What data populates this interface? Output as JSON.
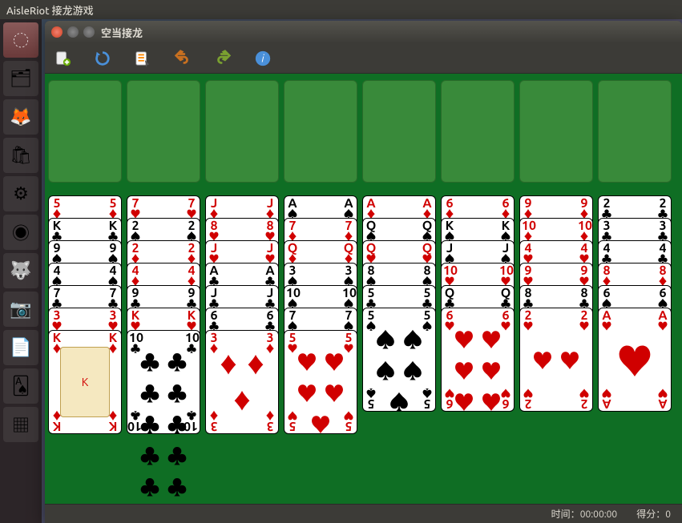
{
  "top_panel": {
    "title": "AisleRiot 接龙游戏"
  },
  "window": {
    "title": "空当接龙"
  },
  "toolbar": {
    "tooltips": {
      "new": "新游戏",
      "restart": "重新开始",
      "select": "选择游戏",
      "undo": "撤销",
      "redo": "重做",
      "hint": "提示"
    }
  },
  "statusbar": {
    "time_label": "时间：",
    "time_value": "00:00:00",
    "score_label": "得分：",
    "score_value": "0"
  },
  "suits": {
    "H": "♥",
    "D": "♦",
    "C": "♣",
    "S": "♠"
  },
  "chart_data": {
    "type": "table",
    "title": "FreeCell tableau — cards listed top-of-column → bottom",
    "columns": [
      [
        {
          "r": "5",
          "s": "D"
        },
        {
          "r": "K",
          "s": "C"
        },
        {
          "r": "9",
          "s": "S"
        },
        {
          "r": "4",
          "s": "S"
        },
        {
          "r": "7",
          "s": "C"
        },
        {
          "r": "3",
          "s": "H"
        },
        {
          "r": "K",
          "s": "D"
        }
      ],
      [
        {
          "r": "7",
          "s": "H"
        },
        {
          "r": "2",
          "s": "S"
        },
        {
          "r": "2",
          "s": "D"
        },
        {
          "r": "4",
          "s": "D"
        },
        {
          "r": "9",
          "s": "C"
        },
        {
          "r": "K",
          "s": "H"
        },
        {
          "r": "10",
          "s": "C"
        }
      ],
      [
        {
          "r": "J",
          "s": "D"
        },
        {
          "r": "8",
          "s": "H"
        },
        {
          "r": "J",
          "s": "H"
        },
        {
          "r": "A",
          "s": "C"
        },
        {
          "r": "J",
          "s": "C"
        },
        {
          "r": "6",
          "s": "C"
        },
        {
          "r": "3",
          "s": "D"
        }
      ],
      [
        {
          "r": "A",
          "s": "S"
        },
        {
          "r": "7",
          "s": "D"
        },
        {
          "r": "Q",
          "s": "D"
        },
        {
          "r": "3",
          "s": "S"
        },
        {
          "r": "10",
          "s": "S"
        },
        {
          "r": "7",
          "s": "S"
        },
        {
          "r": "5",
          "s": "H"
        }
      ],
      [
        {
          "r": "A",
          "s": "D"
        },
        {
          "r": "Q",
          "s": "S"
        },
        {
          "r": "Q",
          "s": "H"
        },
        {
          "r": "8",
          "s": "S"
        },
        {
          "r": "5",
          "s": "C"
        },
        {
          "r": "5",
          "s": "S"
        }
      ],
      [
        {
          "r": "6",
          "s": "D"
        },
        {
          "r": "K",
          "s": "S"
        },
        {
          "r": "J",
          "s": "S"
        },
        {
          "r": "10",
          "s": "H"
        },
        {
          "r": "Q",
          "s": "C"
        },
        {
          "r": "6",
          "s": "H"
        }
      ],
      [
        {
          "r": "9",
          "s": "D"
        },
        {
          "r": "10",
          "s": "D"
        },
        {
          "r": "4",
          "s": "H"
        },
        {
          "r": "9",
          "s": "H"
        },
        {
          "r": "8",
          "s": "C"
        },
        {
          "r": "2",
          "s": "H"
        }
      ],
      [
        {
          "r": "2",
          "s": "C"
        },
        {
          "r": "3",
          "s": "C"
        },
        {
          "r": "4",
          "s": "C"
        },
        {
          "r": "8",
          "s": "D"
        },
        {
          "r": "6",
          "s": "S"
        },
        {
          "r": "A",
          "s": "H"
        }
      ]
    ],
    "freecells": [
      null,
      null,
      null,
      null
    ],
    "foundations": [
      null,
      null,
      null,
      null
    ]
  },
  "launcher_icons": [
    {
      "name": "dash-icon",
      "glyph": "◌"
    },
    {
      "name": "files-icon",
      "glyph": "🗂"
    },
    {
      "name": "firefox-icon",
      "glyph": "🦊"
    },
    {
      "name": "software-icon",
      "glyph": "🛍"
    },
    {
      "name": "settings-icon",
      "glyph": "⚙"
    },
    {
      "name": "chrome-icon",
      "glyph": "◉"
    },
    {
      "name": "gimp-icon",
      "glyph": "🐺"
    },
    {
      "name": "screenshot-icon",
      "glyph": "📷"
    },
    {
      "name": "writer-icon",
      "glyph": "📄"
    },
    {
      "name": "aisleriot-icon",
      "glyph": "🂡"
    },
    {
      "name": "workspace-icon",
      "glyph": "▦"
    }
  ]
}
